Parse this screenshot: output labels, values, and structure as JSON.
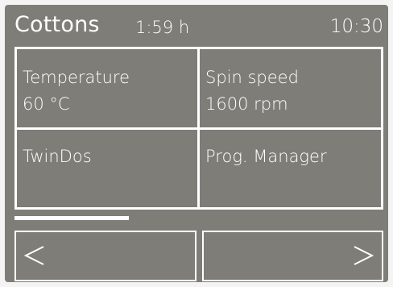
{
  "header": {
    "program": "Cottons",
    "duration": "1:59 h",
    "clock": "10:30"
  },
  "tiles": [
    {
      "label": "Temperature",
      "value": "60 °C"
    },
    {
      "label": "Spin speed",
      "value": "1600 rpm"
    },
    {
      "label": "TwinDos"
    },
    {
      "label": "Prog. Manager"
    }
  ],
  "progress": {
    "fraction": 0.31
  },
  "nav": {
    "prev_icon": "chevron-left-icon",
    "next_icon": "chevron-right-icon"
  },
  "colors": {
    "screen_background": "#7f7d78",
    "foreground": "#ffffff"
  }
}
